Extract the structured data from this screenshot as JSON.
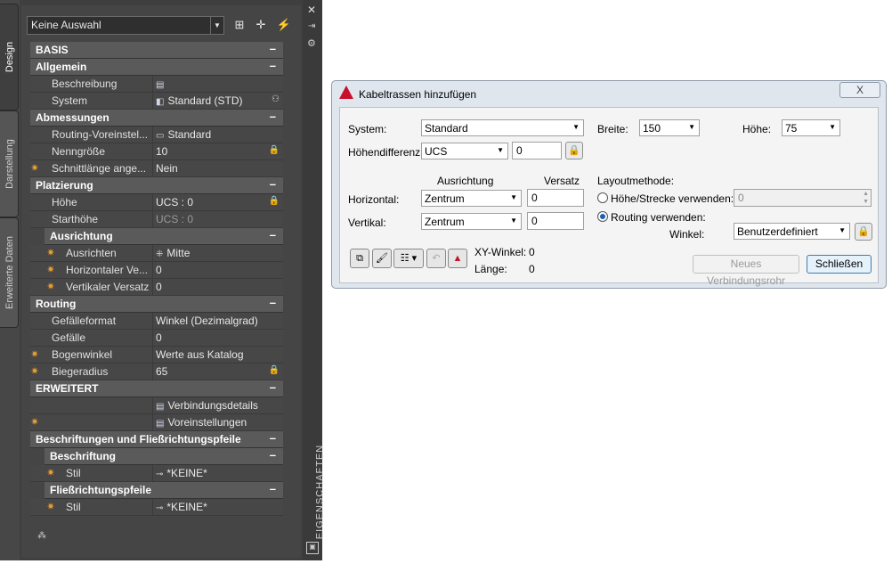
{
  "palette": {
    "selection": "Keine Auswahl",
    "tabs": [
      "Design",
      "Darstellung",
      "Erweiterte Daten"
    ],
    "side_title": "EIGENSCHAFTEN",
    "rows": [
      {
        "kind": "cat",
        "label": "BASIS",
        "sign": "–"
      },
      {
        "kind": "cat",
        "label": "Allgemein",
        "sign": "–"
      },
      {
        "kind": "prop",
        "label": "Beschreibung",
        "value": "",
        "icon": "▤",
        "star": false,
        "lock": false,
        "dim": false
      },
      {
        "kind": "prop",
        "label": "System",
        "value": "Standard (STD)",
        "icon": "◧",
        "star": false,
        "lock": "⚇",
        "dim": false
      },
      {
        "kind": "cat",
        "label": "Abmessungen",
        "sign": "–"
      },
      {
        "kind": "prop",
        "label": "Routing-Voreinstel...",
        "value": "Standard",
        "icon": "▭",
        "star": false,
        "lock": false,
        "dim": false
      },
      {
        "kind": "prop",
        "label": "Nenngröße",
        "value": "10",
        "icon": "",
        "star": false,
        "lock": "🔒",
        "dim": false
      },
      {
        "kind": "prop",
        "label": "Schnittlänge ange...",
        "value": "Nein",
        "icon": "",
        "star": true,
        "lock": false,
        "dim": false
      },
      {
        "kind": "cat",
        "label": "Platzierung",
        "sign": "–"
      },
      {
        "kind": "prop",
        "label": "Höhe",
        "value": "UCS : 0",
        "icon": "",
        "star": false,
        "lock": "🔒",
        "dim": false
      },
      {
        "kind": "prop",
        "label": "Starthöhe",
        "value": "UCS : 0",
        "icon": "",
        "star": false,
        "lock": false,
        "dim": true
      },
      {
        "kind": "subcat",
        "label": "Ausrichtung",
        "sign": "–"
      },
      {
        "kind": "prop",
        "label": "Ausrichten",
        "value": "Mitte",
        "icon": "⁜",
        "star": true,
        "lock": false,
        "dim": false,
        "sub": true
      },
      {
        "kind": "prop",
        "label": "Horizontaler Ve...",
        "value": "0",
        "icon": "",
        "star": true,
        "lock": false,
        "dim": false,
        "sub": true
      },
      {
        "kind": "prop",
        "label": "Vertikaler Versatz",
        "value": "0",
        "icon": "",
        "star": true,
        "lock": false,
        "dim": false,
        "sub": true
      },
      {
        "kind": "cat",
        "label": "Routing",
        "sign": "–"
      },
      {
        "kind": "prop",
        "label": "Gefälleformat",
        "value": "Winkel (Dezimalgrad)",
        "icon": "",
        "star": false,
        "lock": false,
        "dim": false
      },
      {
        "kind": "prop",
        "label": "Gefälle",
        "value": "0",
        "icon": "",
        "star": false,
        "lock": false,
        "dim": false
      },
      {
        "kind": "prop",
        "label": "Bogenwinkel",
        "value": "Werte aus Katalog",
        "icon": "",
        "star": true,
        "lock": false,
        "dim": false
      },
      {
        "kind": "prop",
        "label": "Biegeradius",
        "value": "65",
        "icon": "",
        "star": true,
        "lock": "🔒",
        "dim": false
      },
      {
        "kind": "cat",
        "label": "ERWEITERT",
        "sign": "–"
      },
      {
        "kind": "prop",
        "label": "",
        "value": "Verbindungsdetails",
        "icon": "▤",
        "star": false,
        "lock": false,
        "dim": false
      },
      {
        "kind": "prop",
        "label": "",
        "value": "Voreinstellungen",
        "icon": "▤",
        "star": true,
        "lock": false,
        "dim": false
      },
      {
        "kind": "cat",
        "label": "Beschriftungen und Fließrichtungspfeile",
        "sign": "–"
      },
      {
        "kind": "subcat",
        "label": "Beschriftung",
        "sign": "–"
      },
      {
        "kind": "prop",
        "label": "Stil",
        "value": "*KEINE*",
        "icon": "⊸",
        "star": true,
        "lock": false,
        "dim": false,
        "sub": true
      },
      {
        "kind": "subcat",
        "label": "Fließrichtungspfeile",
        "sign": "–"
      },
      {
        "kind": "prop",
        "label": "Stil",
        "value": "*KEINE*",
        "icon": "⊸",
        "star": true,
        "lock": false,
        "dim": false,
        "sub": true
      }
    ]
  },
  "dialog": {
    "title": "Kabeltrassen hinzufügen",
    "system_label": "System:",
    "system_value": "Standard",
    "breite_label": "Breite:",
    "breite_value": "150",
    "hoehe_label": "Höhe:",
    "hoehe_value": "75",
    "hoehendiff_label": "Höhendifferenz",
    "hoehendiff_combo": "UCS",
    "hoehendiff_value": "0",
    "ausrichtung_header": "Ausrichtung",
    "versatz_header": "Versatz",
    "horizontal_label": "Horizontal:",
    "horizontal_value": "Zentrum",
    "horizontal_offset": "0",
    "vertikal_label": "Vertikal:",
    "vertikal_value": "Zentrum",
    "vertikal_offset": "0",
    "layout_label": "Layoutmethode:",
    "radio_hoehe_label": "Höhe/Strecke verwenden:",
    "radio_hoehe_value": "0",
    "radio_routing_label": "Routing verwenden:",
    "winkel_label": "Winkel:",
    "winkel_value": "Benutzerdefiniert",
    "xy_label": "XY-Winkel:",
    "xy_value": "0",
    "laenge_label": "Länge:",
    "laenge_value": "0",
    "new_button": "Neues Verbindungsrohr",
    "close_button": "Schließen",
    "close_x": "X"
  }
}
